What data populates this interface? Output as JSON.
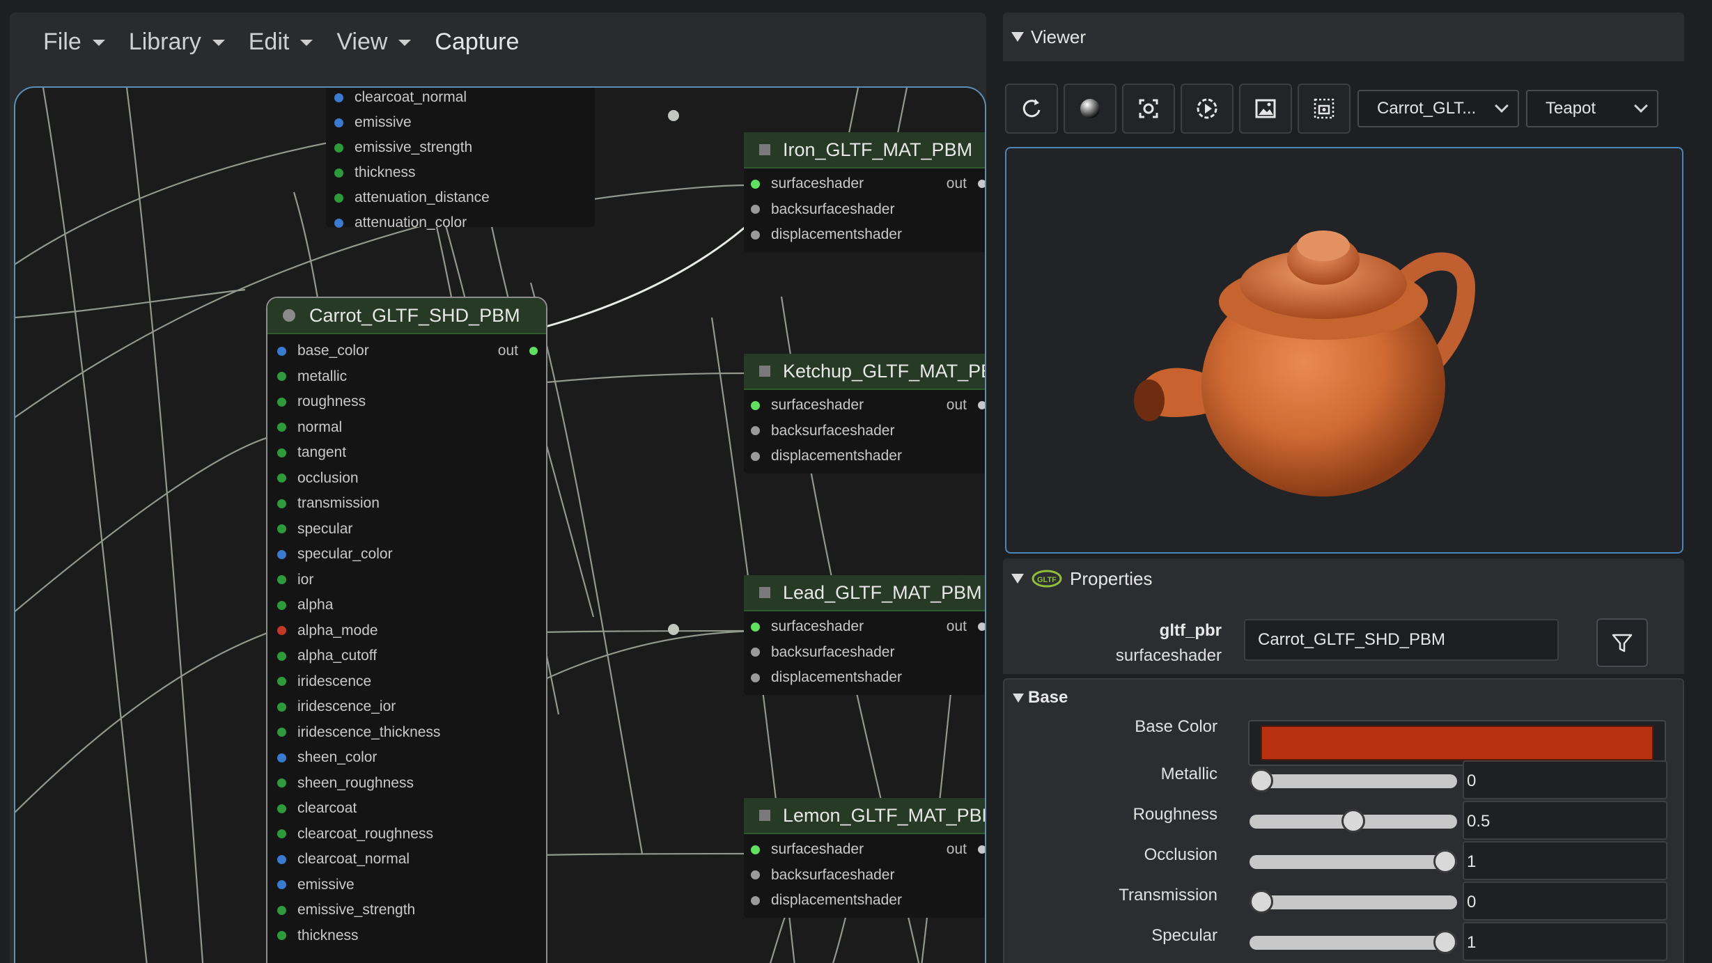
{
  "menubar": {
    "items": [
      {
        "label": "File",
        "has_dropdown": true
      },
      {
        "label": "Library",
        "has_dropdown": true
      },
      {
        "label": "Edit",
        "has_dropdown": true
      },
      {
        "label": "View",
        "has_dropdown": true
      },
      {
        "label": "Capture",
        "has_dropdown": false
      }
    ]
  },
  "graph": {
    "partial_node": {
      "ports": [
        {
          "label": "clearcoat_normal",
          "color": "#3a7bd0"
        },
        {
          "label": "emissive",
          "color": "#3a7bd0"
        },
        {
          "label": "emissive_strength",
          "color": "#2f9a3c"
        },
        {
          "label": "thickness",
          "color": "#2f9a3c"
        },
        {
          "label": "attenuation_distance",
          "color": "#2f9a3c"
        },
        {
          "label": "attenuation_color",
          "color": "#3a7bd0"
        }
      ]
    },
    "shader_node": {
      "title": "Carrot_GLTF_SHD_PBM",
      "output_label": "out",
      "ports": [
        {
          "label": "base_color",
          "color": "#3a7bd0"
        },
        {
          "label": "metallic",
          "color": "#2f9a3c"
        },
        {
          "label": "roughness",
          "color": "#2f9a3c"
        },
        {
          "label": "normal",
          "color": "#2f9a3c"
        },
        {
          "label": "tangent",
          "color": "#2f9a3c"
        },
        {
          "label": "occlusion",
          "color": "#2f9a3c"
        },
        {
          "label": "transmission",
          "color": "#2f9a3c"
        },
        {
          "label": "specular",
          "color": "#2f9a3c"
        },
        {
          "label": "specular_color",
          "color": "#3a7bd0"
        },
        {
          "label": "ior",
          "color": "#2f9a3c"
        },
        {
          "label": "alpha",
          "color": "#2f9a3c"
        },
        {
          "label": "alpha_mode",
          "color": "#c23a26"
        },
        {
          "label": "alpha_cutoff",
          "color": "#2f9a3c"
        },
        {
          "label": "iridescence",
          "color": "#2f9a3c"
        },
        {
          "label": "iridescence_ior",
          "color": "#2f9a3c"
        },
        {
          "label": "iridescence_thickness",
          "color": "#2f9a3c"
        },
        {
          "label": "sheen_color",
          "color": "#3a7bd0"
        },
        {
          "label": "sheen_roughness",
          "color": "#2f9a3c"
        },
        {
          "label": "clearcoat",
          "color": "#2f9a3c"
        },
        {
          "label": "clearcoat_roughness",
          "color": "#2f9a3c"
        },
        {
          "label": "clearcoat_normal",
          "color": "#3a7bd0"
        },
        {
          "label": "emissive",
          "color": "#3a7bd0"
        },
        {
          "label": "emissive_strength",
          "color": "#2f9a3c"
        },
        {
          "label": "thickness",
          "color": "#2f9a3c"
        }
      ]
    },
    "material_nodes": [
      {
        "title": "Iron_GLTF_MAT_PBM",
        "output_label": "out",
        "ports": [
          "surfaceshader",
          "backsurfaceshader",
          "displacementshader"
        ]
      },
      {
        "title": "Ketchup_GLTF_MAT_PBM",
        "output_label": "out",
        "ports": [
          "surfaceshader",
          "backsurfaceshader",
          "displacementshader"
        ]
      },
      {
        "title": "Lead_GLTF_MAT_PBM",
        "output_label": "out",
        "ports": [
          "surfaceshader",
          "backsurfaceshader",
          "displacementshader"
        ]
      },
      {
        "title": "Lemon_GLTF_MAT_PBM",
        "output_label": "out",
        "ports": [
          "surfaceshader",
          "backsurfaceshader",
          "displacementshader"
        ]
      }
    ]
  },
  "viewer": {
    "title": "Viewer",
    "toolbar_icons": [
      "reset-view-icon",
      "sphere-shading-icon",
      "frame-selection-icon",
      "turntable-icon",
      "environment-image-icon",
      "capture-frame-icon"
    ],
    "material_select": "Carrot_GLT...",
    "geometry_select": "Teapot",
    "model_color": "#d06a35"
  },
  "properties": {
    "title": "Properties",
    "icon": "gltf-logo-icon",
    "type_category": "gltf_pbr",
    "type_output": "surfaceshader",
    "name_value": "Carrot_GLTF_SHD_PBM",
    "section_title": "Base",
    "base_color": {
      "label": "Base Color",
      "value": "#b83212"
    },
    "sliders": [
      {
        "label": "Metallic",
        "value": 0,
        "display": "0"
      },
      {
        "label": "Roughness",
        "value": 0.5,
        "display": "0.5"
      },
      {
        "label": "Occlusion",
        "value": 1,
        "display": "1"
      },
      {
        "label": "Transmission",
        "value": 0,
        "display": "0"
      },
      {
        "label": "Specular",
        "value": 1,
        "display": "1"
      }
    ]
  }
}
